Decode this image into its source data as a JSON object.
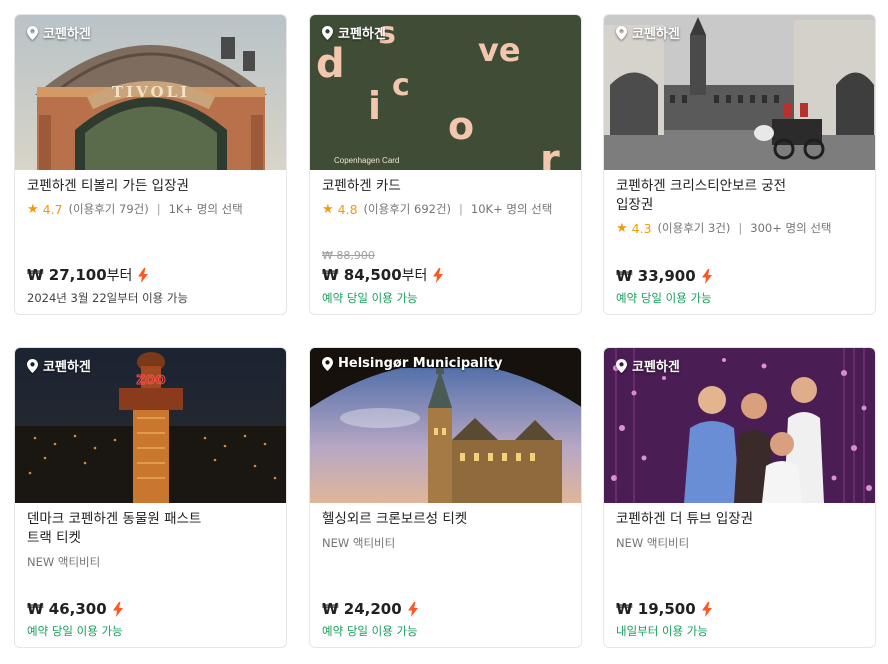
{
  "colors": {
    "accent_green": "#17a05d",
    "rating_orange": "#f09b0a",
    "lightning": "#ff5722"
  },
  "cards": [
    {
      "location": "코펜하겐",
      "image_text": "TIVOLI",
      "title": "코펜하겐 티볼리 가든 입장권",
      "rating": "4.7",
      "reviews": "(이용후기 79건)",
      "popularity": "1K+ 명의 선택",
      "price": "₩ 27,100",
      "price_suffix": "부터",
      "availability": "2024년 3월 22일부터 이용 가능"
    },
    {
      "location": "코펜하겐",
      "image_text": "Copenhagen Card",
      "image_letters": [
        "d",
        "s",
        "c",
        "i",
        "ve",
        "o",
        "r"
      ],
      "title": "코펜하겐 카드",
      "rating": "4.8",
      "reviews": "(이용후기 692건)",
      "popularity": "10K+ 명의 선택",
      "original_price": "₩ 88,900",
      "price": "₩ 84,500",
      "price_suffix": "부터",
      "availability": "예약 당일 이용 가능"
    },
    {
      "location": "코펜하겐",
      "title_line1": "코펜하겐 크리스티안보르 궁전",
      "title_line2": "입장권",
      "rating": "4.3",
      "reviews": "(이용후기 3건)",
      "popularity": "300+ 명의 선택",
      "price": "₩ 33,900",
      "availability": "예약 당일 이용 가능"
    },
    {
      "location": "코펜하겐",
      "image_text": "ZOO",
      "title_line1": "덴마크 코펜하겐 동물원 패스트",
      "title_line2": "트랙 티켓",
      "tag": "NEW 액티비티",
      "price": "₩ 46,300",
      "availability": "예약 당일 이용 가능"
    },
    {
      "location": "Helsingør Municipality",
      "title": "헬싱외르 크론보르성 티켓",
      "tag": "NEW 액티비티",
      "price": "₩ 24,200",
      "availability": "예약 당일 이용 가능"
    },
    {
      "location": "코펜하겐",
      "title": "코펜하겐 더 튜브 입장권",
      "tag": "NEW 액티비티",
      "price": "₩ 19,500",
      "availability": "내일부터 이용 가능"
    }
  ]
}
